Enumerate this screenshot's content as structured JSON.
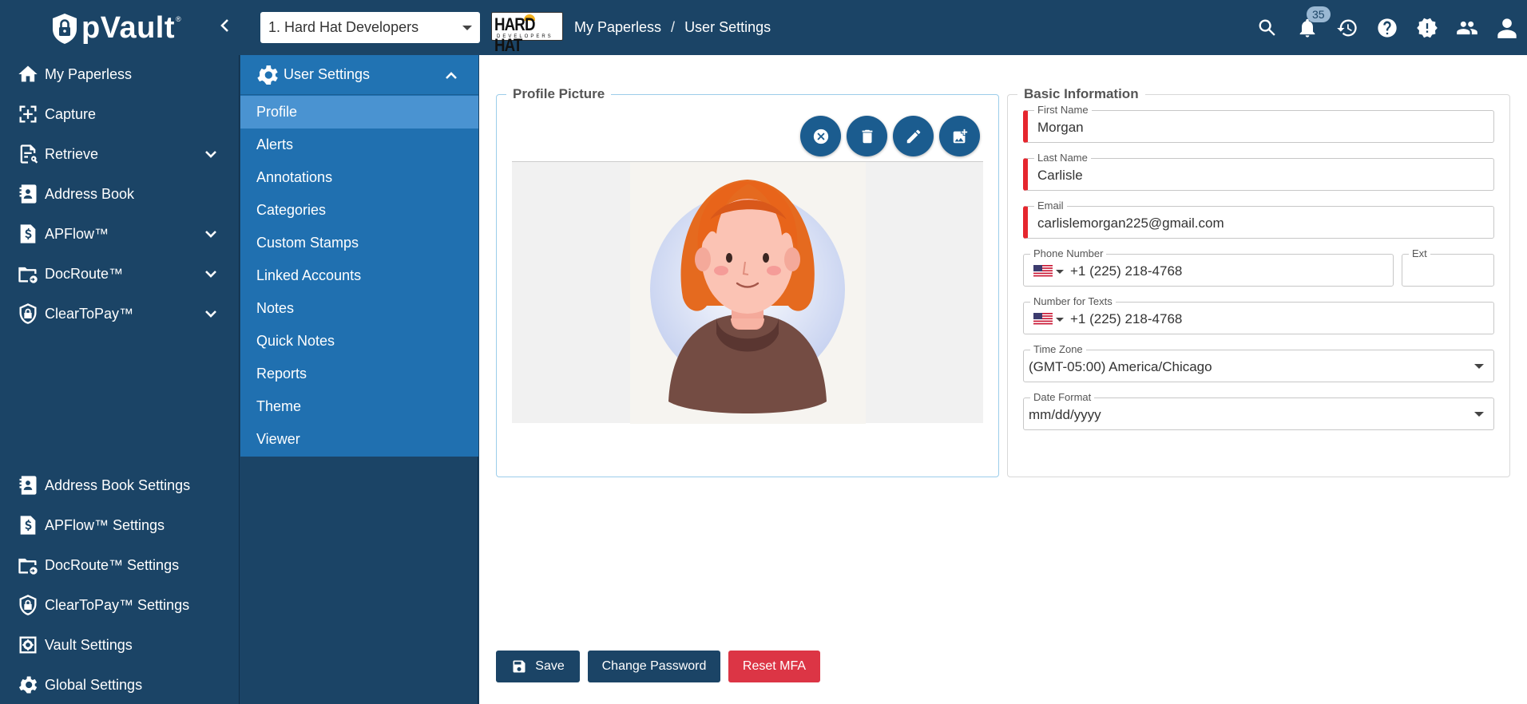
{
  "app": {
    "logo_text": "pVault",
    "logo_mark": "®",
    "organization": "1. Hard Hat Developers",
    "company_logo_text": "HARD HAT",
    "company_logo_sub": "DEVELOPERS",
    "breadcrumb": [
      "My Paperless",
      "User Settings"
    ],
    "breadcrumb_sep": "/",
    "notification_count": "35"
  },
  "top_icons": [
    "search-icon",
    "bell-icon",
    "history-icon",
    "help-icon",
    "alert-icon",
    "users-icon",
    "user-icon"
  ],
  "sidebar": {
    "top_items": [
      {
        "label": "My Paperless",
        "icon": "home-icon",
        "expandable": false
      },
      {
        "label": "Capture",
        "icon": "capture-icon",
        "expandable": false
      },
      {
        "label": "Retrieve",
        "icon": "retrieve-icon",
        "expandable": true
      },
      {
        "label": "Address Book",
        "icon": "address-book-icon",
        "expandable": false
      },
      {
        "label": "APFlow™",
        "icon": "apflow-icon",
        "expandable": true
      },
      {
        "label": "DocRoute™",
        "icon": "docroute-icon",
        "expandable": true
      },
      {
        "label": "ClearToPay™",
        "icon": "cleartopay-icon",
        "expandable": true
      }
    ],
    "bottom_items": [
      {
        "label": "Address Book Settings",
        "icon": "address-book-icon"
      },
      {
        "label": "APFlow™ Settings",
        "icon": "apflow-icon"
      },
      {
        "label": "DocRoute™ Settings",
        "icon": "docroute-icon"
      },
      {
        "label": "ClearToPay™ Settings",
        "icon": "cleartopay-icon"
      },
      {
        "label": "Vault Settings",
        "icon": "vault-icon"
      },
      {
        "label": "Global Settings",
        "icon": "gear-icon"
      }
    ]
  },
  "submenu": {
    "title": "User Settings",
    "items": [
      "Profile",
      "Alerts",
      "Annotations",
      "Categories",
      "Custom Stamps",
      "Linked Accounts",
      "Notes",
      "Quick Notes",
      "Reports",
      "Theme",
      "Viewer"
    ],
    "active": "Profile"
  },
  "profile_picture": {
    "legend": "Profile Picture",
    "actions": [
      "clear-icon",
      "delete-icon",
      "edit-icon",
      "add-photo-icon"
    ]
  },
  "basic_info": {
    "legend": "Basic Information",
    "first_name": {
      "label": "First Name",
      "value": "Morgan"
    },
    "last_name": {
      "label": "Last Name",
      "value": "Carlisle"
    },
    "email": {
      "label": "Email",
      "value": "carlislemorgan225@gmail.com"
    },
    "phone": {
      "label": "Phone Number",
      "value": "+1 (225) 218-4768"
    },
    "ext": {
      "label": "Ext",
      "value": ""
    },
    "texts": {
      "label": "Number for Texts",
      "value": "+1 (225) 218-4768"
    },
    "timezone": {
      "label": "Time Zone",
      "value": "(GMT-05:00) America/Chicago"
    },
    "date_format": {
      "label": "Date Format",
      "value": "mm/dd/yyyy"
    }
  },
  "buttons": {
    "save": "Save",
    "change_password": "Change Password",
    "reset_mfa": "Reset MFA"
  },
  "colors": {
    "primary": "#1b4466",
    "submenu": "#2070b0",
    "active": "#4a93d1",
    "danger": "#dc3545",
    "required": "#e5262e"
  }
}
